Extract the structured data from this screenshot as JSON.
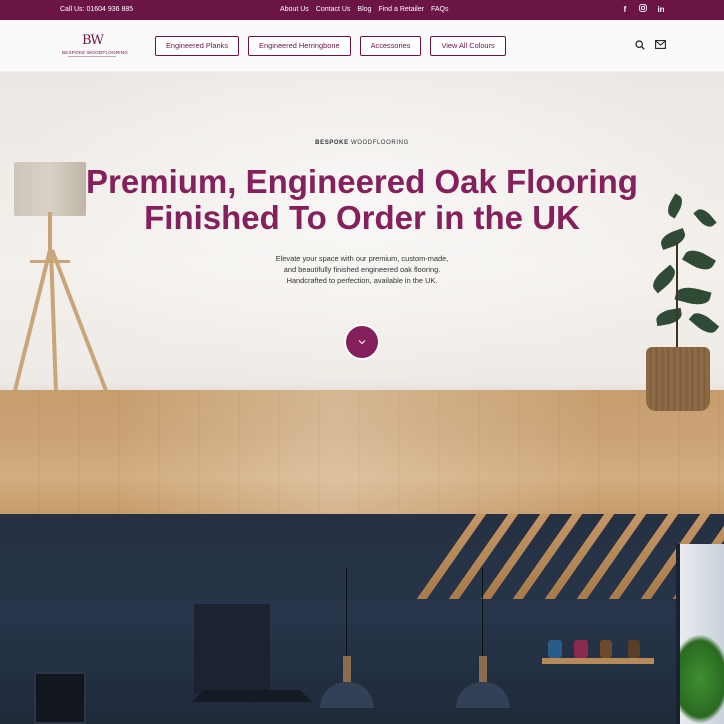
{
  "topbar": {
    "phone": "Call Us: 01604 936 885",
    "links": [
      "About Us",
      "Contact Us",
      "Blog",
      "Find a Retailer",
      "FAQs"
    ],
    "social": [
      "facebook-icon",
      "instagram-icon",
      "linkedin-icon"
    ]
  },
  "header": {
    "logo": {
      "monogram": "BW",
      "name": "BESPOKE WOODFLOORING"
    },
    "nav": [
      "Engineered Planks",
      "Engineered Herringbone",
      "Accessories",
      "View All Colours"
    ],
    "icons": [
      "search-icon",
      "mail-icon"
    ]
  },
  "hero": {
    "eyebrow_bold": "BESPOKE",
    "eyebrow_rest": " WOODFLOORING",
    "title_line1": "Premium, Engineered Oak Flooring",
    "title_line2": "Finished To Order in the UK",
    "subtitle_line1": "Elevate your space with our premium, custom-made,",
    "subtitle_line2": "and beautifully finished engineered oak flooring.",
    "subtitle_line3": "Handcrafted to perfection, available in the UK."
  },
  "colors": {
    "brand": "#6b1446",
    "accent": "#84205b"
  }
}
